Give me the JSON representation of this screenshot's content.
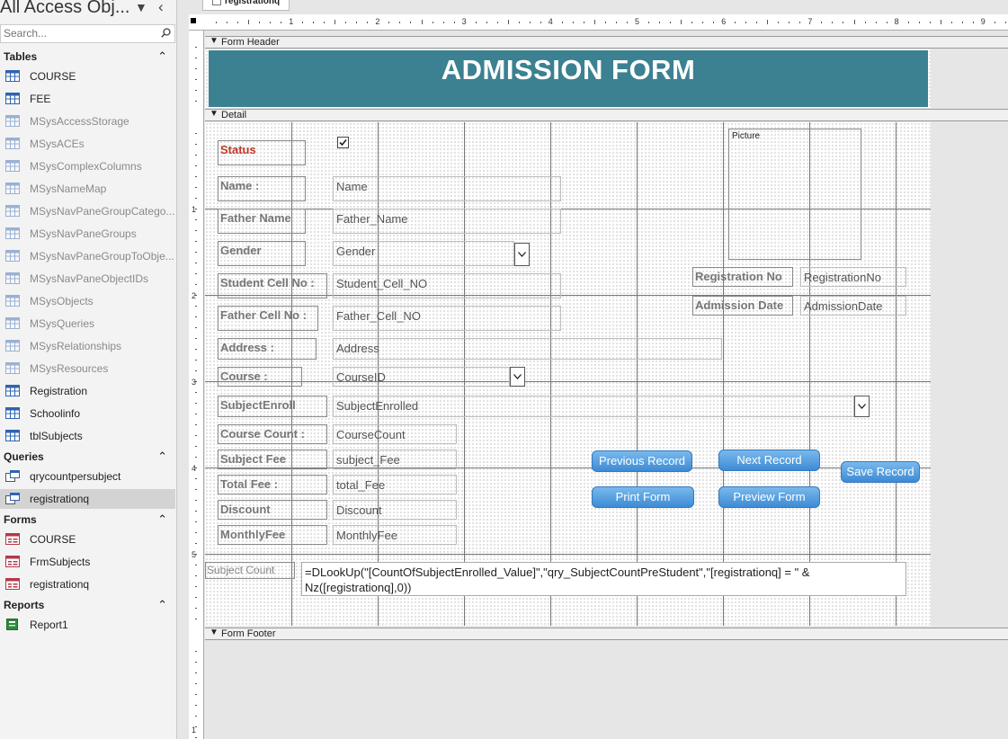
{
  "nav": {
    "title": "All Access Obj...",
    "search_placeholder": "Search...",
    "groups": [
      {
        "label": "Tables",
        "items": [
          {
            "label": "COURSE",
            "icon": "table-icon"
          },
          {
            "label": "FEE",
            "icon": "table-icon"
          },
          {
            "label": "MSysAccessStorage",
            "icon": "table-icon",
            "system": true
          },
          {
            "label": "MSysACEs",
            "icon": "table-icon",
            "system": true
          },
          {
            "label": "MSysComplexColumns",
            "icon": "table-icon",
            "system": true
          },
          {
            "label": "MSysNameMap",
            "icon": "table-icon",
            "system": true
          },
          {
            "label": "MSysNavPaneGroupCatego...",
            "icon": "table-icon",
            "system": true
          },
          {
            "label": "MSysNavPaneGroups",
            "icon": "table-icon",
            "system": true
          },
          {
            "label": "MSysNavPaneGroupToObje...",
            "icon": "table-icon",
            "system": true
          },
          {
            "label": "MSysNavPaneObjectIDs",
            "icon": "table-icon",
            "system": true
          },
          {
            "label": "MSysObjects",
            "icon": "table-icon",
            "system": true
          },
          {
            "label": "MSysQueries",
            "icon": "table-icon",
            "system": true
          },
          {
            "label": "MSysRelationships",
            "icon": "table-icon",
            "system": true
          },
          {
            "label": "MSysResources",
            "icon": "table-icon",
            "system": true
          },
          {
            "label": "Registration",
            "icon": "table-icon"
          },
          {
            "label": "Schoolinfo",
            "icon": "table-icon"
          },
          {
            "label": "tblSubjects",
            "icon": "table-icon"
          }
        ]
      },
      {
        "label": "Queries",
        "items": [
          {
            "label": "qrycountpersubject",
            "icon": "query-icon"
          },
          {
            "label": "registrationq",
            "icon": "query-icon",
            "selected": true
          }
        ]
      },
      {
        "label": "Forms",
        "items": [
          {
            "label": "COURSE",
            "icon": "form-icon"
          },
          {
            "label": "FrmSubjects",
            "icon": "form-icon"
          },
          {
            "label": "registrationq",
            "icon": "form-icon"
          }
        ]
      },
      {
        "label": "Reports",
        "items": [
          {
            "label": "Report1",
            "icon": "report-icon"
          }
        ]
      }
    ]
  },
  "tab": {
    "label": "registrationq"
  },
  "ruler": {
    "numbers": [
      "1",
      "2",
      "3",
      "4",
      "5",
      "6",
      "7",
      "8",
      "9"
    ],
    "left_numbers": [
      "1",
      "2",
      "3",
      "4",
      "5"
    ],
    "footer_number": "1"
  },
  "sections": {
    "header": "Form Header",
    "detail": "Detail",
    "footer": "Form Footer"
  },
  "form": {
    "title": "ADMISSION FORM",
    "labels": {
      "status": "Status",
      "name": "Name :",
      "father_name": "Father Name",
      "gender": "Gender",
      "student_cell": "Student Cell No :",
      "father_cell": "Father Cell No :",
      "address": "Address :",
      "course": "Course :",
      "subject_enroll": "SubjectEnroll",
      "course_count": "Course Count :",
      "subject_fee": "Subject Fee",
      "total_fee": "Total Fee :",
      "discount": "Discount",
      "monthly_fee": "MonthlyFee",
      "registration_no": "Registration No",
      "admission_date": "Admission Date",
      "picture": "Picture",
      "subject_count": "Subject Count"
    },
    "fields": {
      "name": "Name",
      "father_name": "Father_Name",
      "gender": "Gender",
      "student_cell": "Student_Cell_NO",
      "father_cell": "Father_Cell_NO",
      "address": "Address",
      "course": "CourseID",
      "subject_enroll": "SubjectEnrolled",
      "course_count": "CourseCount",
      "subject_fee": "subject_Fee",
      "total_fee": "total_Fee",
      "discount": "Discount",
      "monthly_fee": "MonthlyFee",
      "registration_no": "RegistrationNo",
      "admission_date": "AdmissionDate",
      "subject_count_expr": "=DLookUp(\"[CountOfSubjectEnrolled_Value]\",\"qry_SubjectCountPreStudent\",\"[registrationq] = \" & Nz([registrationq],0))"
    },
    "buttons": {
      "previous": "Previous Record",
      "next": "Next Record",
      "save": "Save Record",
      "print": "Print Form",
      "preview": "Preview Form"
    }
  },
  "colors": {
    "header_band": "#3b8191",
    "button": "#4a94dc",
    "status_label": "#c0392b"
  }
}
